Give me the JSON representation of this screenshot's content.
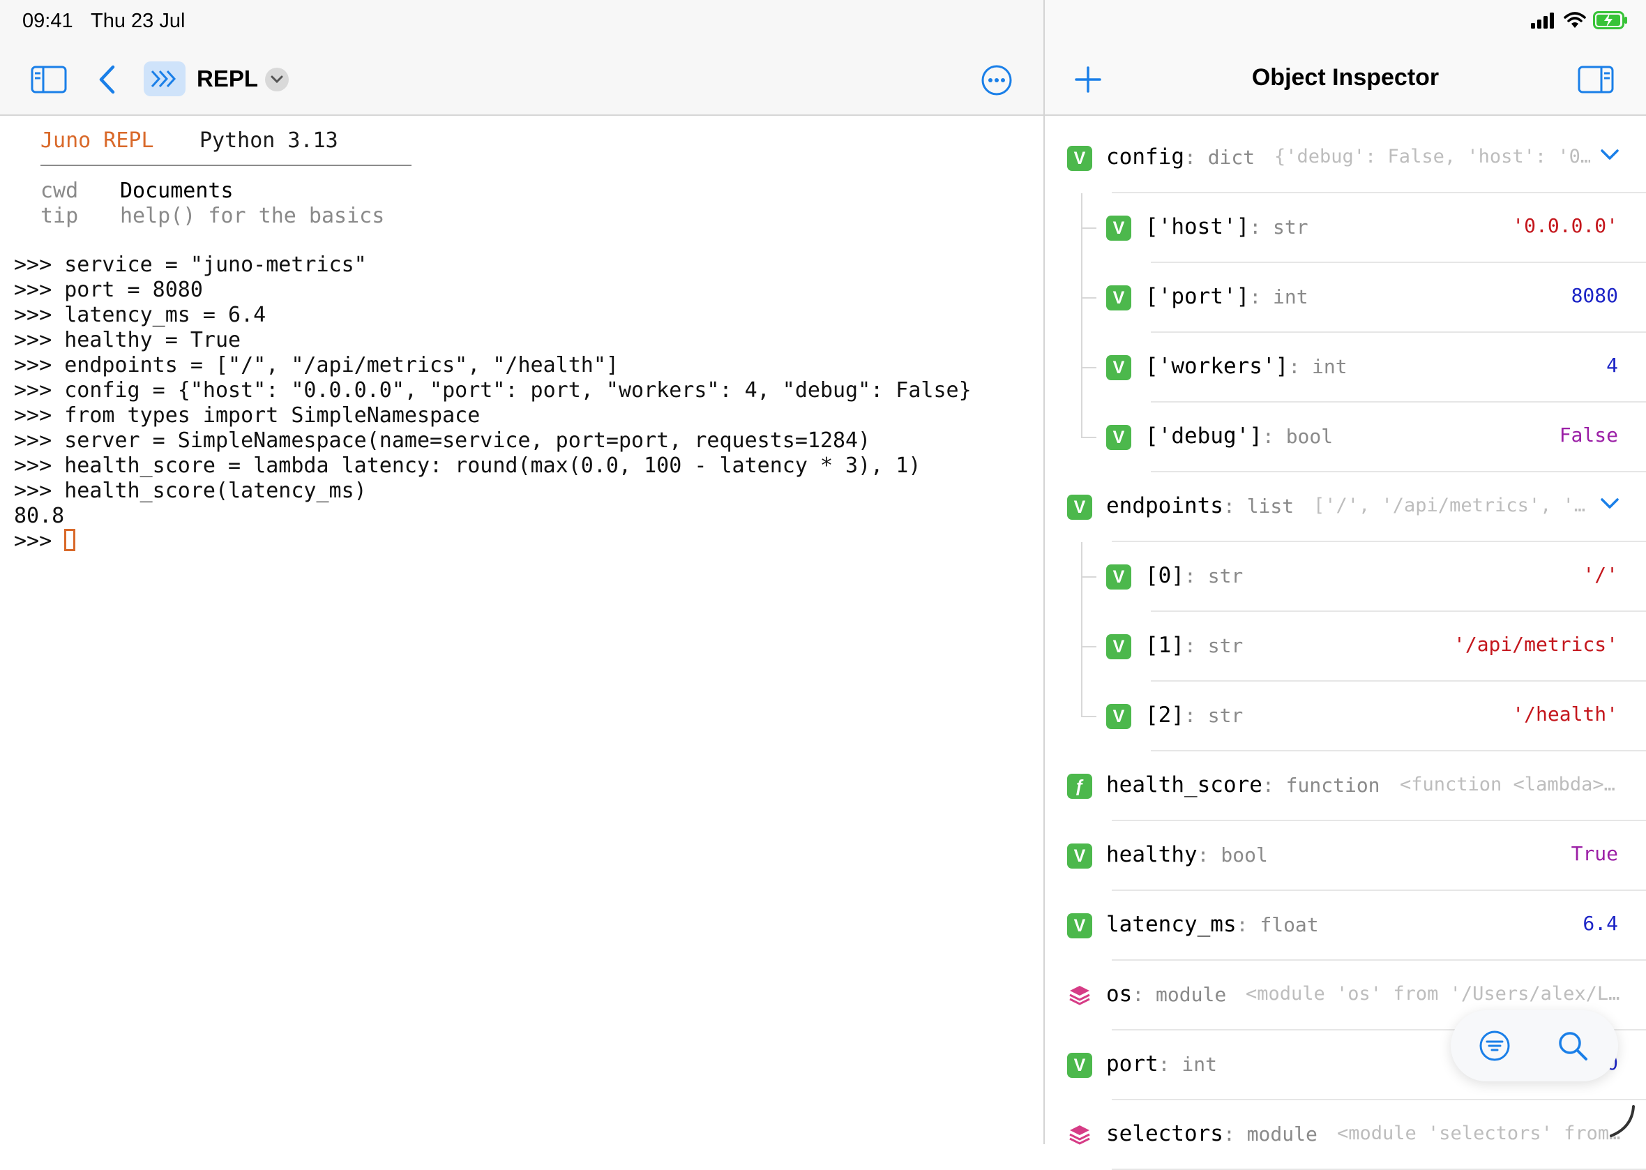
{
  "status": {
    "time": "09:41",
    "date": "Thu 23 Jul"
  },
  "toolbar": {
    "title": "REPL"
  },
  "inspector": {
    "title": "Object Inspector"
  },
  "repl": {
    "brand": "Juno REPL",
    "python": "Python 3.13",
    "cwd_key": "cwd",
    "cwd_value": "Documents",
    "tip_key": "tip",
    "tip_value": "help() for the basics",
    "lines": [
      ">>> service = \"juno-metrics\"",
      ">>> port = 8080",
      ">>> latency_ms = 6.4",
      ">>> healthy = True",
      ">>> endpoints = [\"/\", \"/api/metrics\", \"/health\"]",
      ">>> config = {\"host\": \"0.0.0.0\", \"port\": port, \"workers\": 4, \"debug\": False}",
      ">>> from types import SimpleNamespace",
      ">>> server = SimpleNamespace(name=service, port=port, requests=1284)",
      ">>> health_score = lambda latency: round(max(0.0, 100 - latency * 3), 1)",
      ">>> health_score(latency_ms)",
      "80.8"
    ],
    "prompt": ">>> "
  },
  "objects": [
    {
      "name": "config",
      "type": "dict",
      "preview": "{'debug': False, 'host': '0…",
      "badge": "V",
      "expanded": true
    },
    {
      "name": "['host']",
      "type": "str",
      "value": "'0.0.0.0'",
      "badge": "V",
      "color": "#c4161c"
    },
    {
      "name": "['port']",
      "type": "int",
      "value": "8080",
      "badge": "V",
      "color": "#1c24c6"
    },
    {
      "name": "['workers']",
      "type": "int",
      "value": "4",
      "badge": "V",
      "color": "#1c24c6"
    },
    {
      "name": "['debug']",
      "type": "bool",
      "value": "False",
      "badge": "V",
      "color": "#9b1fa6"
    },
    {
      "name": "endpoints",
      "type": "list",
      "preview": "['/', '/api/metrics', '…",
      "badge": "V",
      "expanded": true
    },
    {
      "name": "[0]",
      "type": "str",
      "value": "'/'",
      "badge": "V",
      "color": "#c4161c"
    },
    {
      "name": "[1]",
      "type": "str",
      "value": "'/api/metrics'",
      "badge": "V",
      "color": "#c4161c"
    },
    {
      "name": "[2]",
      "type": "str",
      "value": "'/health'",
      "badge": "V",
      "color": "#c4161c"
    },
    {
      "name": "health_score",
      "type": "function",
      "preview": "<function <lambda>…",
      "badge": "f"
    },
    {
      "name": "healthy",
      "type": "bool",
      "value": "True",
      "badge": "V",
      "color": "#9b1fa6"
    },
    {
      "name": "latency_ms",
      "type": "float",
      "value": "6.4",
      "badge": "V",
      "color": "#1c24c6"
    },
    {
      "name": "os",
      "type": "module",
      "preview": "<module 'os' from '/Users/alex/L…",
      "badge": "module"
    },
    {
      "name": "port",
      "type": "int",
      "value": "8080",
      "badge": "V",
      "color": "#1c24c6"
    },
    {
      "name": "selectors",
      "type": "module",
      "preview": "<module 'selectors' from…",
      "badge": "module"
    }
  ],
  "colors": {
    "accent": "#1a7fe8",
    "brand": "#d9692a",
    "badge_green": "#4cb84c",
    "module_pink": "#d63c86"
  },
  "icons": [
    "sidebar-left-icon",
    "back-chevron-icon",
    "repl-icon",
    "chevron-down-icon",
    "more-icon",
    "plus-icon",
    "sidebar-right-icon",
    "filter-icon",
    "search-icon",
    "resize-handle-icon"
  ]
}
